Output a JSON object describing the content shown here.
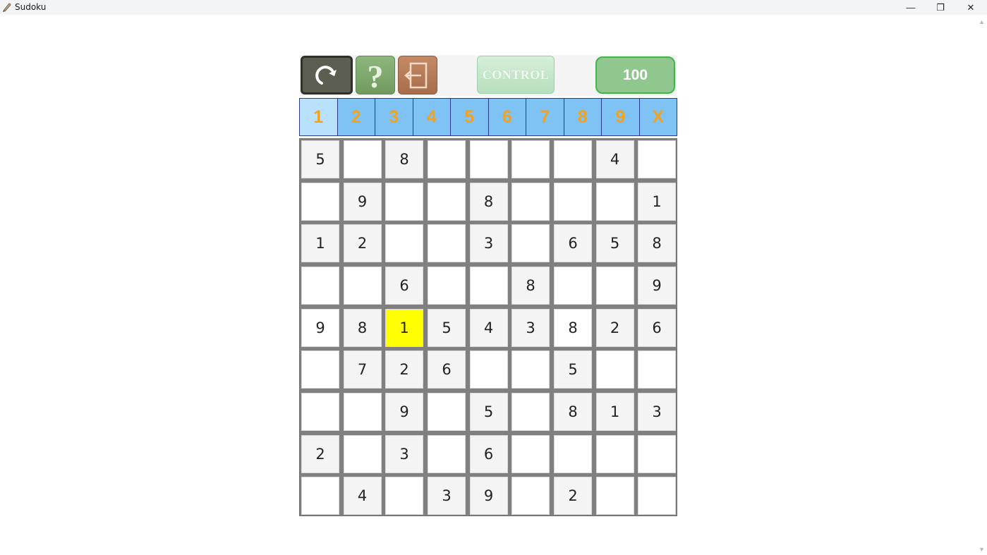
{
  "window": {
    "title": "Sudoku",
    "controls": {
      "minimize": "—",
      "maximize": "❐",
      "close": "✕"
    }
  },
  "toolbar": {
    "undo_icon": "undo-arrow-icon",
    "help_icon": "question-mark-icon",
    "exit_icon": "exit-door-icon",
    "control_label": "CONTROL",
    "score": "100"
  },
  "picker": {
    "selected_index": 0,
    "items": [
      "1",
      "2",
      "3",
      "4",
      "5",
      "6",
      "7",
      "8",
      "9",
      "X"
    ]
  },
  "board": {
    "selected": [
      4,
      2
    ],
    "cells": [
      [
        "5",
        "",
        "8",
        "",
        "",
        "",
        "",
        "4",
        ""
      ],
      [
        "",
        "9",
        "",
        "",
        "8",
        "",
        "",
        "",
        "1"
      ],
      [
        "1",
        "2",
        "",
        "",
        "3",
        "",
        "6",
        "5",
        "8"
      ],
      [
        "",
        "",
        "6",
        "",
        "",
        "8",
        "",
        "",
        "9"
      ],
      [
        "9",
        "8",
        "1",
        "5",
        "4",
        "3",
        "8",
        "2",
        "6"
      ],
      [
        "",
        "7",
        "2",
        "6",
        "",
        "",
        "5",
        "",
        ""
      ],
      [
        "",
        "",
        "9",
        "",
        "5",
        "",
        "8",
        "1",
        "3"
      ],
      [
        "2",
        "",
        "3",
        "",
        "6",
        "",
        "",
        "",
        ""
      ],
      [
        "",
        "4",
        "",
        "3",
        "9",
        "",
        "2",
        "",
        ""
      ]
    ],
    "given": [
      [
        1,
        0,
        1,
        0,
        0,
        0,
        0,
        1,
        0
      ],
      [
        0,
        1,
        0,
        0,
        1,
        0,
        0,
        0,
        1
      ],
      [
        1,
        1,
        0,
        0,
        1,
        0,
        1,
        1,
        1
      ],
      [
        0,
        0,
        1,
        0,
        0,
        1,
        0,
        0,
        1
      ],
      [
        0,
        1,
        1,
        1,
        1,
        1,
        0,
        1,
        1
      ],
      [
        0,
        1,
        1,
        1,
        0,
        0,
        1,
        0,
        0
      ],
      [
        0,
        0,
        1,
        0,
        1,
        0,
        1,
        1,
        1
      ],
      [
        1,
        0,
        1,
        0,
        1,
        0,
        0,
        0,
        0
      ],
      [
        0,
        1,
        0,
        1,
        1,
        0,
        1,
        0,
        0
      ]
    ]
  }
}
